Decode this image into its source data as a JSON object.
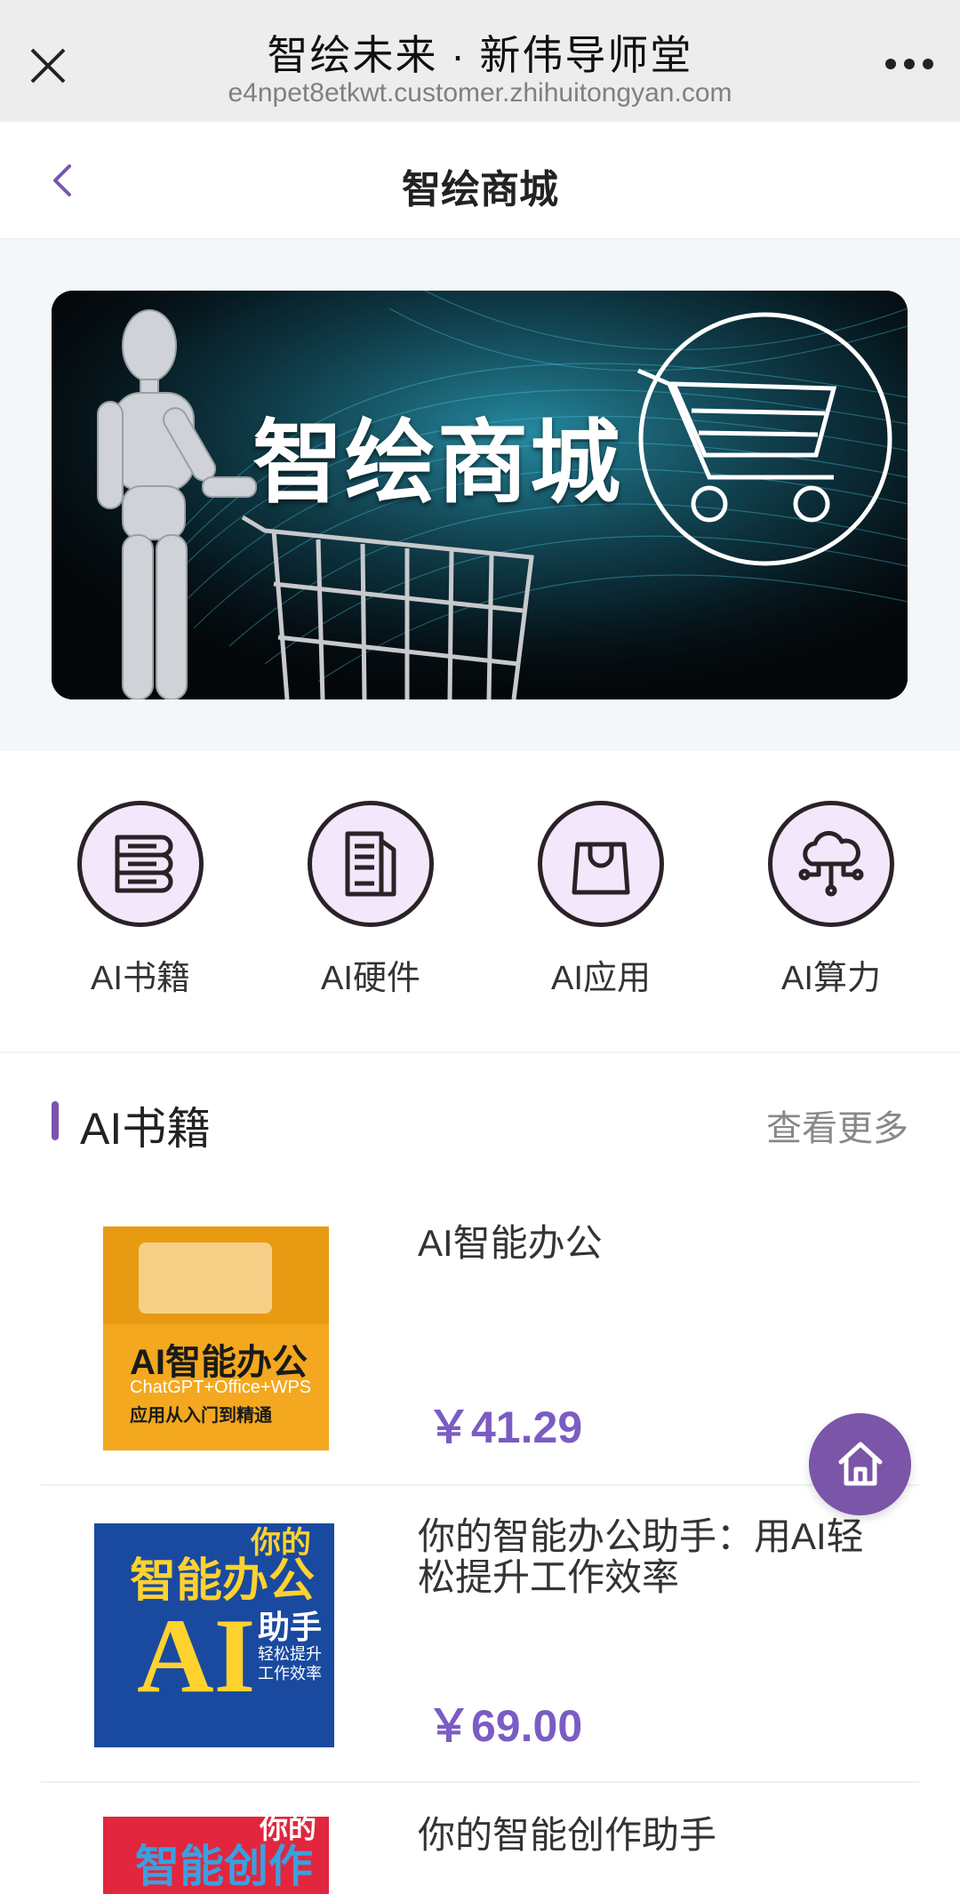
{
  "topbar": {
    "title": "智绘未来 · 新伟导师堂",
    "url": "e4npet8etkwt.customer.zhihuitongyan.com"
  },
  "header": {
    "title": "智绘商城"
  },
  "banner": {
    "title": "智绘商城"
  },
  "categories": [
    {
      "label": "AI书籍",
      "icon": "books-icon"
    },
    {
      "label": "AI硬件",
      "icon": "document-device-icon"
    },
    {
      "label": "AI应用",
      "icon": "shopping-bag-icon"
    },
    {
      "label": "AI算力",
      "icon": "cloud-network-icon"
    }
  ],
  "section": {
    "title": "AI书籍",
    "more": "查看更多"
  },
  "items": [
    {
      "name": "AI智能办公",
      "price": "￥41.29",
      "cover": {
        "title": "AI智能办公",
        "subtitle": "ChatGPT+Office+WPS",
        "line": "应用从入门到精通"
      }
    },
    {
      "name": "你的智能办公助手：用AI轻松提升工作效率",
      "price": "￥69.00",
      "cover": {
        "top": "你的",
        "title": "智能办公",
        "big": "AI",
        "side": "助手",
        "line": "轻松提升工作效率"
      }
    },
    {
      "name": "你的智能创作助手",
      "cover": {
        "top": "你的",
        "title": "智能创作"
      }
    }
  ],
  "colors": {
    "accent": "#7b5cc4",
    "fab": "#7a55a8",
    "circle_fill": "#f2e7fb"
  }
}
